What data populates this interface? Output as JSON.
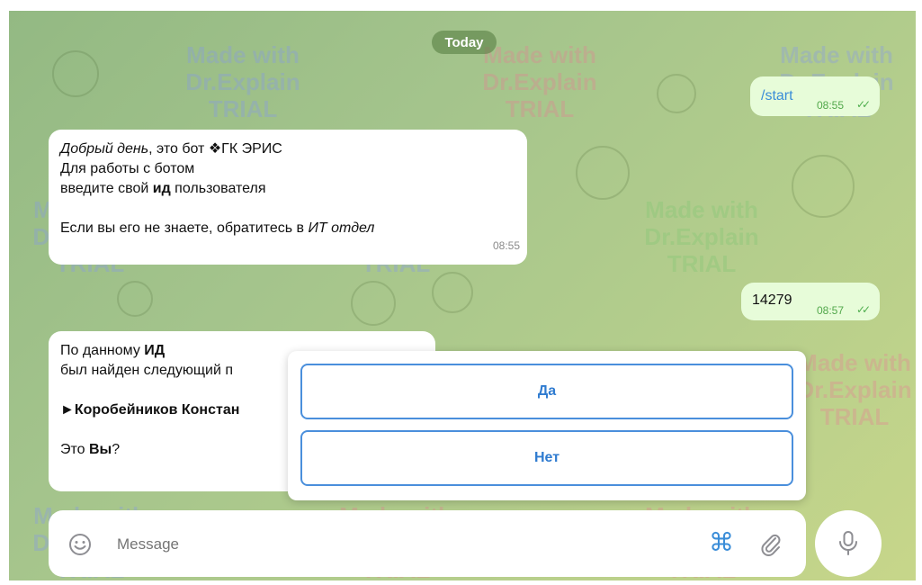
{
  "date_label": "Today",
  "messages": [
    {
      "direction": "out",
      "text": "/start",
      "time": "08:55"
    },
    {
      "direction": "in",
      "line1_italic": "Добрый день",
      "line1_rest": ", это бот ❖ГК ЭРИС",
      "line2": "Для работы с ботом",
      "line3_pre": "введите свой ",
      "line3_bold": "ид",
      "line3_post": " пользователя",
      "line4_pre": "Если вы его не знаете, обратитесь в ",
      "line4_italic": "ИТ отдел",
      "time": "08:55"
    },
    {
      "direction": "out",
      "text": "14279",
      "time": "08:57"
    },
    {
      "direction": "in",
      "line1_pre": "По данному ",
      "line1_bold": "ИД",
      "line2": "был найден следующий п",
      "line3": "►Коробейников Констан",
      "line4_pre": "Это ",
      "line4_bold": "Вы",
      "line4_post": "?"
    }
  ],
  "keyboard": {
    "yes": "Да",
    "no": "Нет"
  },
  "composer": {
    "placeholder": "Message"
  },
  "watermark": {
    "line1": "Made with",
    "line2": "Dr.Explain",
    "line3": "TRIAL"
  },
  "colors": {
    "accent": "#4a8fdc",
    "outgoing_bubble": "#e7fcd9",
    "check": "#4fae4e"
  }
}
